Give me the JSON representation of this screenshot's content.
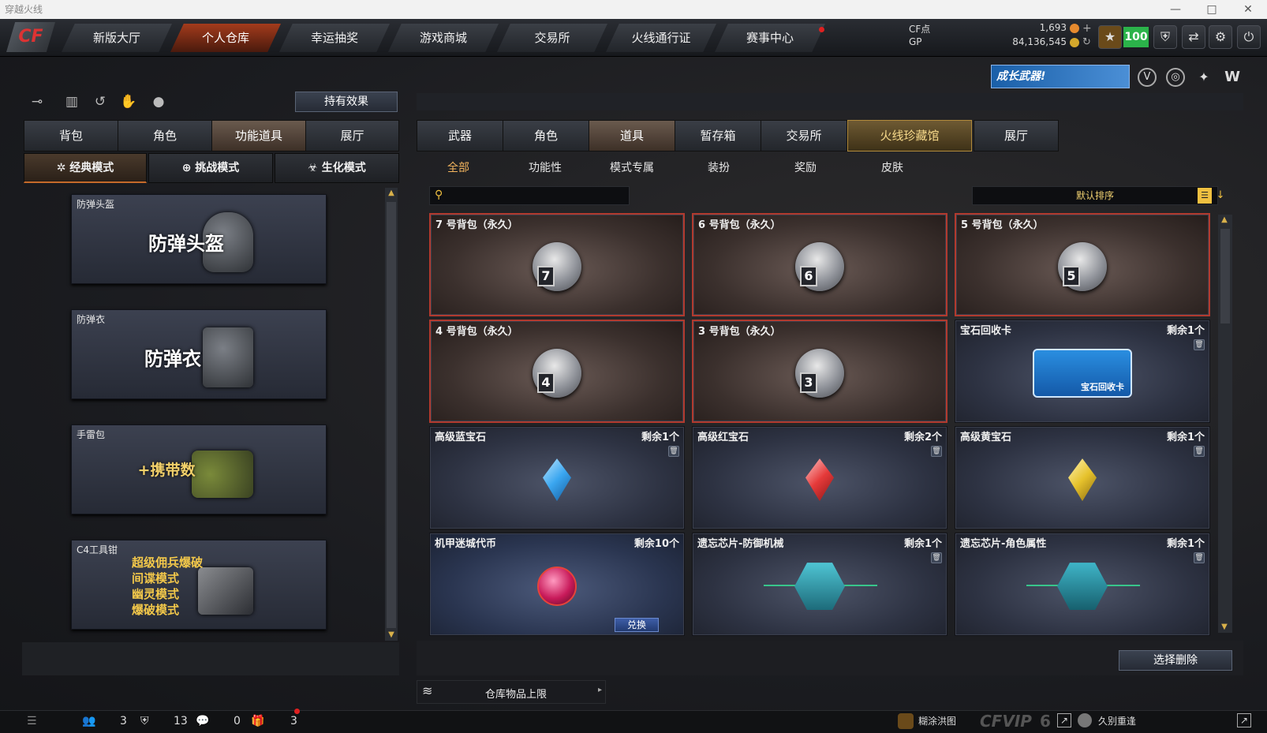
{
  "window": {
    "title": "穿越火线",
    "controls": [
      "—",
      "□",
      "✕"
    ]
  },
  "nav": {
    "tabs": [
      "新版大厅",
      "个人仓库",
      "幸运抽奖",
      "游戏商城",
      "交易所",
      "火线通行证",
      "赛事中心"
    ],
    "active_index": 1
  },
  "currency": {
    "cf_label": "CF点",
    "cf_value": "1,693",
    "gp_label": "GP",
    "gp_value": "84,136,545",
    "level": "100"
  },
  "promo": {
    "label": "成长武器!"
  },
  "left": {
    "hold_effect": "持有效果",
    "tabs": [
      "背包",
      "角色",
      "功能道具",
      "展厅"
    ],
    "active_tab": 2,
    "modes": [
      "经典模式",
      "挑战模式",
      "生化模式"
    ],
    "active_mode": 0,
    "cards": [
      {
        "label": "防弹头盔",
        "title": "防弹头盔"
      },
      {
        "label": "防弹衣",
        "title": "防弹衣"
      },
      {
        "label": "手雷包",
        "title": "+携带数"
      },
      {
        "label": "C4工具钳",
        "lines": [
          "超级佣兵爆破",
          "间谍模式",
          "幽灵模式",
          "爆破模式"
        ]
      }
    ]
  },
  "right": {
    "tabs": [
      "武器",
      "角色",
      "道具",
      "暂存箱",
      "交易所",
      "火线珍藏馆",
      "展厅"
    ],
    "active_tab": 2,
    "gold_tab": 5,
    "subtabs": [
      "全部",
      "功能性",
      "模式专属",
      "装扮",
      "奖励",
      "皮肤"
    ],
    "active_subtab": 0,
    "search_placeholder": "",
    "sort": "默认排序",
    "items": [
      {
        "name": "7 号背包（永久）",
        "type": "bag",
        "num": "7"
      },
      {
        "name": "6 号背包（永久）",
        "type": "bag",
        "num": "6"
      },
      {
        "name": "5 号背包（永久）",
        "type": "bag",
        "num": "5"
      },
      {
        "name": "4 号背包（永久）",
        "type": "bag",
        "num": "4"
      },
      {
        "name": "3 号背包（永久）",
        "type": "bag",
        "num": "3"
      },
      {
        "name": "宝石回收卡",
        "remain": "剩余1个",
        "type": "card",
        "card_text": "宝石回收卡"
      },
      {
        "name": "高级蓝宝石",
        "remain": "剩余1个",
        "type": "gem",
        "color": "#3aa6f0"
      },
      {
        "name": "高级红宝石",
        "remain": "剩余2个",
        "type": "gem",
        "color": "#e53a3a"
      },
      {
        "name": "高级黄宝石",
        "remain": "剩余1个",
        "type": "gem",
        "color": "#e6c22c"
      },
      {
        "name": "机甲迷城代币",
        "remain": "剩余10个",
        "type": "coin",
        "action": "兑换"
      },
      {
        "name": "遗忘芯片-防御机械",
        "remain": "剩余1个",
        "type": "chip"
      },
      {
        "name": "遗忘芯片-角色属性",
        "remain": "剩余1个",
        "type": "chip"
      }
    ],
    "delete_button": "选择删除",
    "capacity_label": "仓库物品上限"
  },
  "footer": {
    "counts": [
      "3",
      "13",
      "0",
      "3"
    ],
    "friend1": "糊涂洪图",
    "vip": "CFVIP",
    "vip_level": "6",
    "friend2": "久别重逢"
  },
  "colors": {
    "accent": "#c56a2a",
    "bag_border": "#b23a2e",
    "gold": "#f2b45e"
  }
}
